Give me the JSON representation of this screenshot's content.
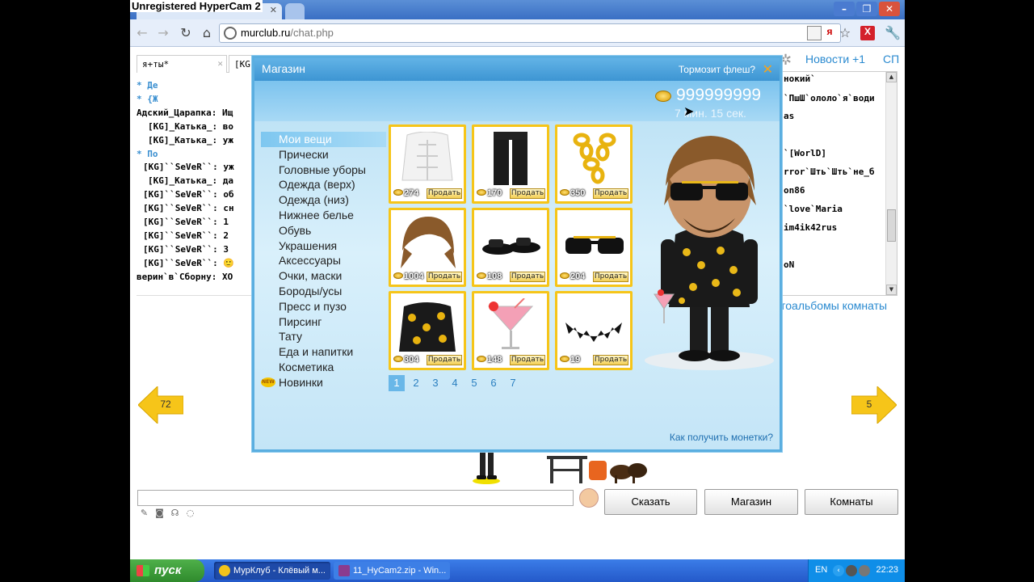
{
  "recorder": {
    "label": "Unregistered HyperCam 2"
  },
  "browser": {
    "tab_close": "✕",
    "window_buttons": {
      "minimize": "–",
      "maximize": "❐",
      "close": "✕"
    },
    "address": {
      "domain": "murclub.ru",
      "path": "/chat.php"
    },
    "icons": {
      "yandex": "я",
      "addon": "Х"
    }
  },
  "chat": {
    "tabs": [
      {
        "label": "я+ты*",
        "close": "✕"
      },
      {
        "label": "[KG]"
      }
    ],
    "lines": [
      {
        "text": "* Де",
        "kind": "sys"
      },
      {
        "text": "* {Ж",
        "kind": "sys"
      },
      {
        "text": "Адский_Царапка: Ищ",
        "kind": "msg"
      },
      {
        "text": "[KG]_Катька_: во",
        "kind": "ind1"
      },
      {
        "text": "[KG]_Катька_: уж",
        "kind": "ind1"
      },
      {
        "text": "* По",
        "kind": "sys"
      },
      {
        "text": "[KG]``SeVeR``: уж",
        "kind": "ind2"
      },
      {
        "text": "[KG]_Катька_: да",
        "kind": "ind1"
      },
      {
        "text": "[KG]``SeVeR``: об",
        "kind": "ind2"
      },
      {
        "text": "[KG]``SeVeR``: сн",
        "kind": "ind2"
      },
      {
        "text": "[KG]``SeVeR``: 1",
        "kind": "ind2"
      },
      {
        "text": "[KG]``SeVeR``: 2",
        "kind": "ind2"
      },
      {
        "text": "[KG]``SeVeR``: 3",
        "kind": "ind2"
      },
      {
        "text": "[KG]``SeVeR``: 🙂",
        "kind": "ind2"
      },
      {
        "text": "верин`в`Сборну: ХО",
        "kind": "msg"
      }
    ]
  },
  "sidebar": {
    "news_label": "Новости +1",
    "sp_label": "СП",
    "users": [
      "нокий`",
      "`ПшШ`ололо`я`води",
      "as",
      "`[WorlD]",
      "rror`Шть`Шть`не_б",
      "on86",
      "`love`Maria",
      "im4ik42rus",
      "oN"
    ],
    "photo_link": "тоальбомы комнаты",
    "scroll": {
      "up": "▲",
      "down": "▼"
    }
  },
  "room": {
    "prev_count": "72",
    "next_count": "5"
  },
  "controls": {
    "input_value": "",
    "say_label": "Сказать",
    "shop_label": "Магазин",
    "rooms_label": "Комнаты"
  },
  "shop": {
    "title": "Магазин",
    "lag_link": "Тормозит флеш?",
    "close": "✕",
    "balance": "999999999",
    "timer": "7 мин. 15 сек.",
    "categories": [
      "Мои вещи",
      "Прически",
      "Головные уборы",
      "Одежда (верх)",
      "Одежда (низ)",
      "Нижнее белье",
      "Обувь",
      "Украшения",
      "Аксессуары",
      "Очки, маски",
      "Бороды/усы",
      "Пресс и пузо",
      "Пирсинг",
      "Тату",
      "Еда и напитки",
      "Косметика",
      "Новинки"
    ],
    "active_category": 0,
    "new_badge": "NEW",
    "sell_label": "Продать",
    "items": [
      {
        "name": "abs",
        "price": "274"
      },
      {
        "name": "pants",
        "price": "170"
      },
      {
        "name": "gold-chain",
        "price": "350"
      },
      {
        "name": "hairstyle",
        "price": "1004"
      },
      {
        "name": "shoes",
        "price": "108"
      },
      {
        "name": "sunglasses",
        "price": "204"
      },
      {
        "name": "jacket",
        "price": "304"
      },
      {
        "name": "cocktail",
        "price": "148"
      },
      {
        "name": "beard",
        "price": "19"
      }
    ],
    "pages": [
      "1",
      "2",
      "3",
      "4",
      "5",
      "6",
      "7"
    ],
    "current_page": 0,
    "how_link": "Как получить монетки?"
  },
  "taskbar": {
    "start_label": "пуск",
    "tasks": [
      {
        "label": "МурКлуб - Клёвый м...",
        "active": true
      },
      {
        "label": "11_HyCam2.zip - Win...",
        "active": false
      }
    ],
    "lang": "EN",
    "clock": "22:23"
  },
  "colors": {
    "shop_border": "#5aaee0",
    "item_border": "#f6c519",
    "link": "#2a8ad0",
    "taskbar": "#2459c9"
  }
}
